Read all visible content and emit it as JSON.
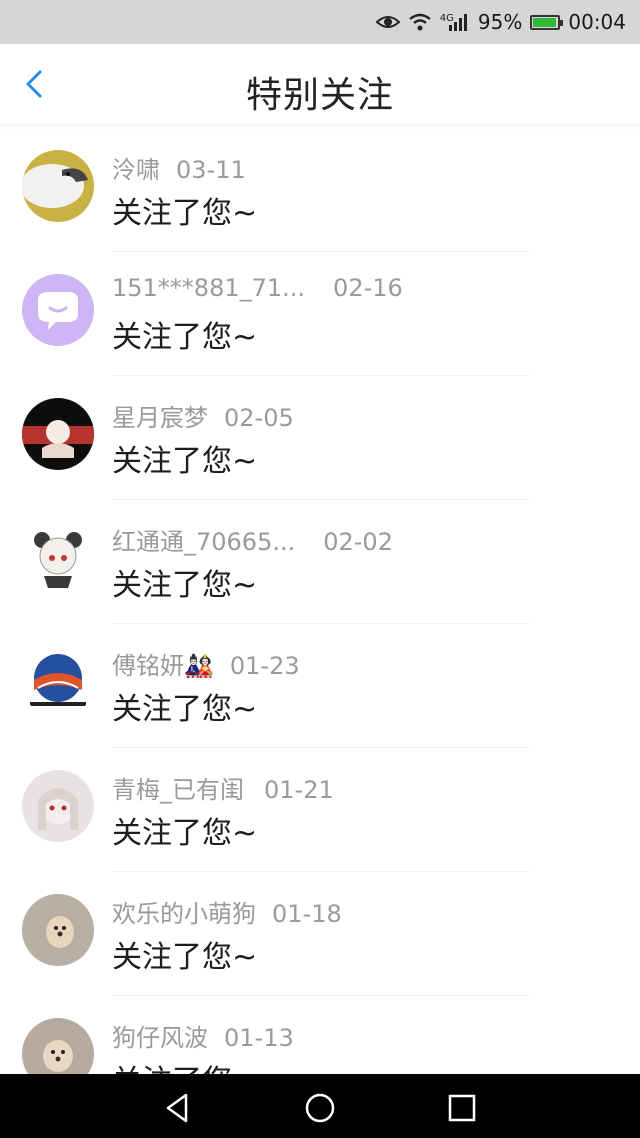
{
  "status_bar": {
    "net_type": "4G",
    "battery": "95%",
    "battery_level": 0.95,
    "time": "00:04"
  },
  "header": {
    "title": "特别关注",
    "back_icon": "chevron-left-icon",
    "accent": "#2a8cf0"
  },
  "list": {
    "items": [
      {
        "name": "泠啸",
        "date": "03-11",
        "message": "关注了您~",
        "avatar": "bird-avatar"
      },
      {
        "name": "151***881_71...",
        "date": "02-16",
        "message": "关注了您~",
        "avatar": "chat-bubble-avatar"
      },
      {
        "name": "星月宸梦",
        "date": "02-05",
        "message": "关注了您~",
        "avatar": "anime-avatar"
      },
      {
        "name": "红通通_70665...",
        "date": "02-02",
        "message": "关注了您~",
        "avatar": "panda-girl-avatar"
      },
      {
        "name": "傅铭妍🎎",
        "date": "01-23",
        "message": "关注了您~",
        "avatar": "logo-avatar"
      },
      {
        "name": "青梅_已有闺",
        "date": "01-21",
        "message": "关注了您~",
        "avatar": "anime-girl-avatar"
      },
      {
        "name": "欢乐的小萌狗",
        "date": "01-18",
        "message": "关注了您~",
        "avatar": "puppy-avatar"
      },
      {
        "name": "狗仔风波",
        "date": "01-13",
        "message": "关注了您~",
        "avatar": "puppy-avatar"
      }
    ]
  },
  "nav_bar": {
    "back_icon": "triangle-back-icon",
    "home_icon": "circle-home-icon",
    "recents_icon": "square-recents-icon"
  }
}
